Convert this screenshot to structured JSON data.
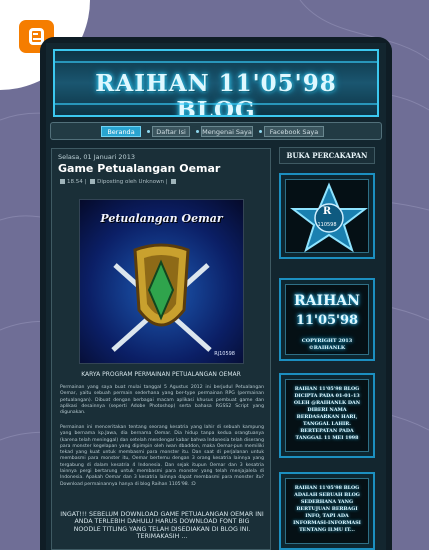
{
  "blog": {
    "banner_title": "RAIHAN 11'05'98 BLOG",
    "nav": [
      "Beranda",
      "Daftar Isi",
      "Mengenai Saya",
      "Facebook Saya"
    ]
  },
  "post": {
    "date": "Selasa, 01 Januari 2013",
    "title": "Game Petualangan Oemar",
    "time": "18.54",
    "author_line": "Diposting oleh Unknown",
    "image": {
      "title": "Petualangan Oemar",
      "credit": "Rj10598"
    },
    "heading": "KARYA PROGRAM PERMAINAN PETUALANGAN OEMAR",
    "paragraph1": "Permainan yang saya buat mulai tanggal 5 Agustus 2012 ini berjudul Petualangan Oemar, yaitu sebuah permain sederhana yang ber-type permainan RPG (permainan petualangan). Dibuat dengan berbagai macam aplikasi khusus pembuat game dan aplikasi desainnya (seperti Adobe Photoshop) serta bahasa RGSS2 Script yang digunakan.",
    "paragraph2": "Permainan ini menceritakan tentang seorang kesatria yang lahir di sebuah kampung yang bernama kp.Jawa, dia bernama Oemar. Dia hidup tanpa kedua orangtuanya (karena telah meninggal) dan setelah mendengar kabar bahwa Indonesia telah diserang para monster kegelapan yang dipimpin oleh iwan dbaddon, maka Oemar-pun memiliki tekad yang kuat untuk membasmi para monster itu. Dan saat di perjalanan untuk membasmi para monster itu, Oemar bertemu dengan 3 orang kesatria lainnya yang tergabung di dalam kesatria 4 Indonesia. Dan sejak itupun Oemar dan 3 kesatria lainnya pergi bertarung untuk membasmi para monster yang telah menjajalela di Indonesia. Apakah Oemar dan 3 kesatria lainnya dapat membasmi para monster itu? Download permainannya hanya di blog Raihan 1105'98. :D",
    "notice": "INGAT!!! SEBELUM DOWNLOAD GAME PETUALANGAN OEMAR INI ANDA TERLEBIH DAHULU HARUS DOWNLOAD FONT BIG NOODLE TITLING YANG TELAH DISEDIAKAN DI BLOG INI. TERIMAKASIH ..."
  },
  "sidebar": {
    "title": "BUKA PERCAKAPAN",
    "badge": {
      "letter": "R",
      "number": "110598"
    },
    "logo": {
      "line1": "RAIHAN",
      "line2": "11'05'98",
      "line3": "COPYRIGHT 2013",
      "line4": "©RAIHANLK"
    },
    "widget3": "RAIHAN 11'05'98 BLOG DICIPTA PADA 01-01-13 OLEH @RAIHANLK DAN DIBERI NAMA BERDASARKAN HARI, TANGGAL LAHIR. BERTEPATAN PADA TANGGAL 11 MEI 1998",
    "widget4": "RAIHAN 11'05'98 BLOG ADALAH SEBUAH BLOG SEDERHANA YANG BERTUJUAN BERBAGI INFO, TAPI ADA INFORMASI-INFORMASI TENTANG ILMU IT..."
  },
  "colors": {
    "page_bg": "#6f6e96",
    "accent_cyan": "#3cc8ef",
    "blogger_orange": "#f57d00"
  }
}
